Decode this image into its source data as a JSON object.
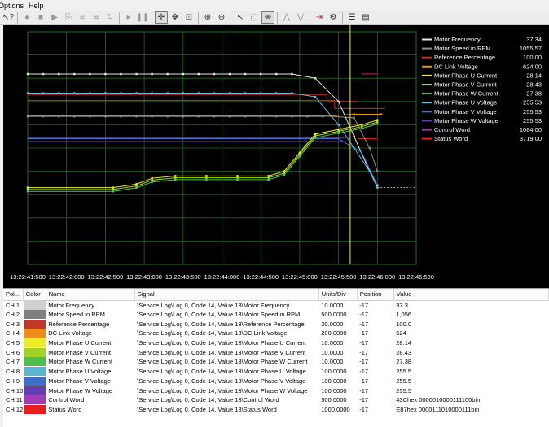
{
  "menu": {
    "items": [
      "Options",
      "Help"
    ]
  },
  "toolbar": {
    "icons": [
      "help-cursor-icon",
      "record-icon",
      "stop-icon",
      "play-icon",
      "export-icon",
      "signal-settings-icon",
      "waveform-icon",
      "loop-icon",
      "play-small-icon",
      "pause-icon",
      "crosshair-icon",
      "pan-icon",
      "zoom-fit-icon",
      "zoom-in-icon",
      "zoom-out-icon",
      "pointer-icon",
      "select-icon",
      "cursor-pair-icon",
      "peak-icon",
      "valley-icon",
      "trigger-icon",
      "settings-icon",
      "list-icon",
      "table-icon"
    ]
  },
  "chart_data": {
    "type": "line",
    "x_ticks": [
      "13:22:41:500",
      "13:22:42:000",
      "13:22:42:500",
      "13:22:43:000",
      "13:22:43:500",
      "13:22:44:000",
      "13:22:44:500",
      "13:22:45:000",
      "13:22:45:500",
      "13:22:46:000",
      "13:22:46:500"
    ],
    "xlim_seconds": [
      41.5,
      46.5
    ],
    "cursor_x_seconds": 45.65,
    "grid": true,
    "legend_position": "top-right",
    "series": [
      {
        "name": "Motor Frequency",
        "value": "37,34",
        "color": "#e6e6e6"
      },
      {
        "name": "Motor Speed in RPM",
        "value": "1055,57",
        "color": "#8c8c8c"
      },
      {
        "name": "Reference Percentage",
        "value": "100,00",
        "color": "#c8281e"
      },
      {
        "name": "DC Link Voltage",
        "value": "624,00",
        "color": "#f08c1e"
      },
      {
        "name": "Motor Phase U Current",
        "value": "28,14",
        "color": "#f0f028"
      },
      {
        "name": "Motor Phase V Current",
        "value": "28,43",
        "color": "#a0dc28"
      },
      {
        "name": "Motor Phase W Current",
        "value": "27,38",
        "color": "#50c850"
      },
      {
        "name": "Motor Phase U Voltage",
        "value": "255,53",
        "color": "#5abedc"
      },
      {
        "name": "Motor Phase V Voltage",
        "value": "255,53",
        "color": "#3c78c8"
      },
      {
        "name": "Motor Phase W Voltage",
        "value": "255,53",
        "color": "#643cb4"
      },
      {
        "name": "Control Word",
        "value": "1084,00",
        "color": "#a03cb4"
      },
      {
        "name": "Status Word",
        "value": "3719,00",
        "color": "#e61e1e"
      }
    ]
  },
  "table": {
    "headers": [
      "Pol...",
      "Color",
      "Name",
      "Signal",
      "Units/Div",
      "Position",
      "Value"
    ],
    "rows": [
      {
        "ch": "CH 1",
        "color": "#d0d0d0",
        "name": "Motor Frequency",
        "signal": "\\Service Log\\Log 0, Code 14, Value 13\\Motor Frequency",
        "units": "10.0000",
        "pos": "-17",
        "value": "37.3"
      },
      {
        "ch": "CH 2",
        "color": "#808080",
        "name": "Motor Speed in RPM",
        "signal": "\\Service Log\\Log 0, Code 14, Value 13\\Motor Speed in RPM",
        "units": "500.0000",
        "pos": "-17",
        "value": "1,056"
      },
      {
        "ch": "CH 3",
        "color": "#c0392b",
        "name": "Reference Percentage",
        "signal": "\\Service Log\\Log 0, Code 14, Value 13\\Reference Percentage",
        "units": "20.0000",
        "pos": "-17",
        "value": "100.0"
      },
      {
        "ch": "CH 4",
        "color": "#f08c1e",
        "name": "DC Link Voltage",
        "signal": "\\Service Log\\Log 0, Code 14, Value 13\\DC Link Voltage",
        "units": "200.0000",
        "pos": "-17",
        "value": "624"
      },
      {
        "ch": "CH 5",
        "color": "#ecec28",
        "name": "Motor Phase U Current",
        "signal": "\\Service Log\\Log 0, Code 14, Value 13\\Motor Phase U Current",
        "units": "10.0000",
        "pos": "-17",
        "value": "28.14"
      },
      {
        "ch": "CH 6",
        "color": "#a0d228",
        "name": "Motor Phase V Current",
        "signal": "\\Service Log\\Log 0, Code 14, Value 13\\Motor Phase V Current",
        "units": "10.0000",
        "pos": "-17",
        "value": "28.43"
      },
      {
        "ch": "CH 7",
        "color": "#4cbe4c",
        "name": "Motor Phase W Current",
        "signal": "\\Service Log\\Log 0, Code 14, Value 13\\Motor Phase W Current",
        "units": "10.0000",
        "pos": "-17",
        "value": "27.38"
      },
      {
        "ch": "CH 8",
        "color": "#5ab4d2",
        "name": "Motor Phase U Voltage",
        "signal": "\\Service Log\\Log 0, Code 14, Value 13\\Motor Phase U Voltage",
        "units": "100.0000",
        "pos": "-17",
        "value": "255.5"
      },
      {
        "ch": "CH 9",
        "color": "#3c6ec8",
        "name": "Motor Phase V Voltage",
        "signal": "\\Service Log\\Log 0, Code 14, Value 13\\Motor Phase V Voltage",
        "units": "100.0000",
        "pos": "-17",
        "value": "255.5"
      },
      {
        "ch": "CH 10",
        "color": "#643cb4",
        "name": "Motor Phase W Voltage",
        "signal": "\\Service Log\\Log 0, Code 14, Value 13\\Motor Phase W Voltage",
        "units": "100.0000",
        "pos": "-17",
        "value": "255.5"
      },
      {
        "ch": "CH 11",
        "color": "#a03cb4",
        "name": "Control Word",
        "signal": "\\Service Log\\Log 0, Code 14, Value 13\\Control Word",
        "units": "500.0000",
        "pos": "-17",
        "value": "43Chex 0000010000111100bin"
      },
      {
        "ch": "CH 12",
        "color": "#e61e1e",
        "name": "Status Word",
        "signal": "\\Service Log\\Log 0, Code 14, Value 13\\Status Word",
        "units": "1000.0000",
        "pos": "-17",
        "value": "E87hex 0000111010000111bin"
      }
    ]
  }
}
